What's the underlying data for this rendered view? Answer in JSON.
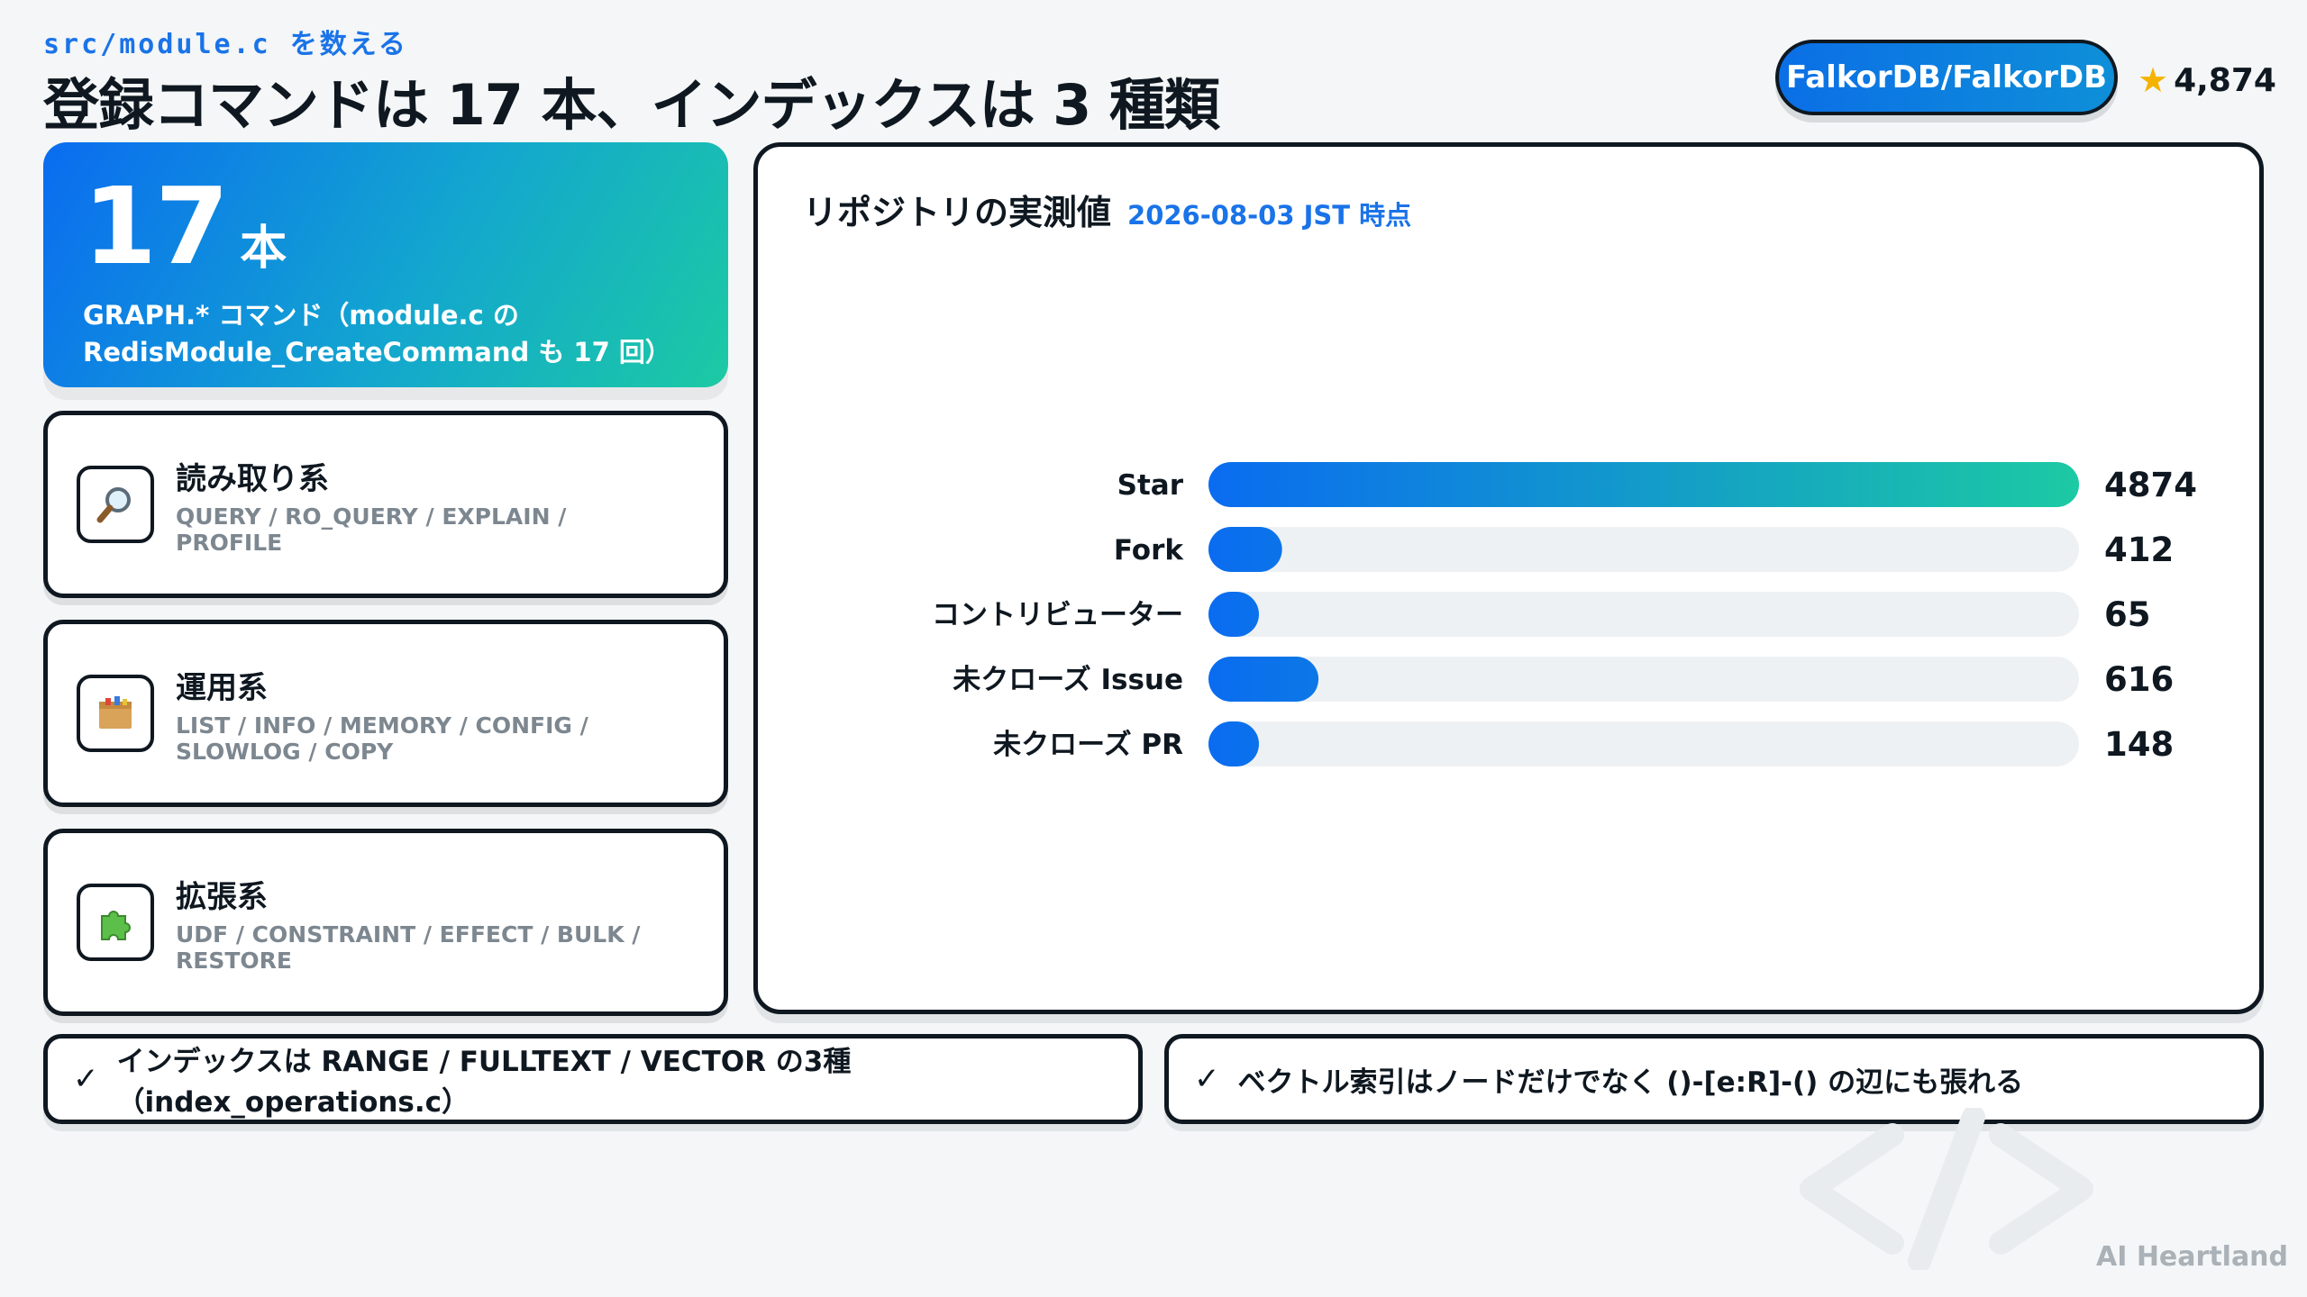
{
  "header": {
    "eyebrow": "src/module.c を数える",
    "title": "登録コマンドは 17 本、インデックスは 3 種類",
    "repo": "FalkorDB/FalkorDB",
    "stars": "4,874"
  },
  "hero": {
    "number": "17",
    "unit": "本",
    "desc_line1": "GRAPH.* コマンド（module.c の",
    "desc_line2": "RedisModule_CreateCommand も 17 回）"
  },
  "categories": [
    {
      "title": "読み取り系",
      "sub": "QUERY / RO_QUERY / EXPLAIN / PROFILE",
      "icon": "magnifier-icon"
    },
    {
      "title": "運用系",
      "sub": "LIST / INFO / MEMORY / CONFIG / SLOWLOG / COPY",
      "icon": "box-icon"
    },
    {
      "title": "拡張系",
      "sub": "UDF / CONSTRAINT / EFFECT / BULK / RESTORE",
      "icon": "puzzle-icon"
    }
  ],
  "panel": {
    "title": "リポジトリの実測値",
    "date": "2026-08-03 JST 時点"
  },
  "chart_data": {
    "type": "bar",
    "orientation": "horizontal",
    "categories": [
      "Star",
      "Fork",
      "コントリビューター",
      "未クローズ Issue",
      "未クローズ PR"
    ],
    "values": [
      4874,
      412,
      65,
      616,
      148
    ],
    "xlim": [
      0,
      4874
    ],
    "grid": false,
    "colors": {
      "bar_start": "#0a6cf0",
      "bar_end": "#1ccaa3",
      "track": "#eef1f3"
    }
  },
  "notes": [
    {
      "check": "✓",
      "text": "インデックスは RANGE / FULLTEXT / VECTOR の3種（index_operations.c）"
    },
    {
      "check": "✓",
      "text": "ベクトル索引はノードだけでなく ()-[e:R]-() の辺にも張れる"
    }
  ],
  "footer": {
    "brand": "AI Heartland"
  },
  "colors": {
    "accent": "#1a73e8",
    "ink": "#0f1820",
    "muted": "#7d8790"
  }
}
